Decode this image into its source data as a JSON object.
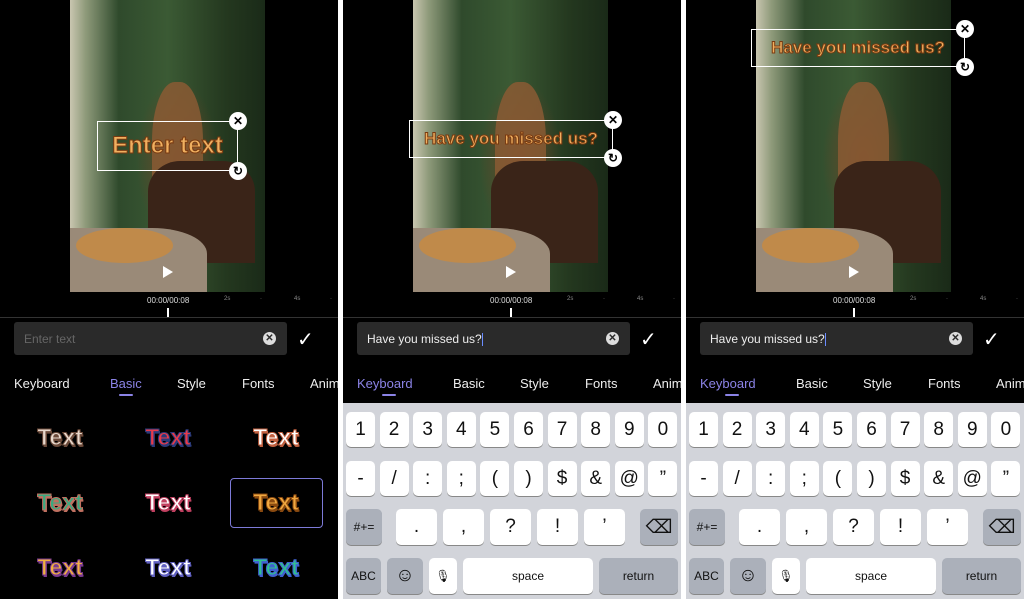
{
  "colors": {
    "accent": "#8b83e6",
    "keyboard_bg": "#d2d4da",
    "key_dark": "#abb0ba"
  },
  "timeline": {
    "time": "00:00/00:08",
    "ticks": [
      "2s",
      "·",
      "4s",
      "·"
    ]
  },
  "tabs": [
    "Keyboard",
    "Basic",
    "Style",
    "Fonts",
    "Anim"
  ],
  "panels": [
    {
      "overlay_text": "Enter text",
      "input_value": "",
      "input_placeholder": "Enter text",
      "active_tab": 1,
      "mode": "styles"
    },
    {
      "overlay_text": "Have you missed us?",
      "input_value": "Have you missed us?",
      "input_placeholder": "",
      "active_tab": 0,
      "mode": "keyboard"
    },
    {
      "overlay_text": "Have you missed us?",
      "input_value": "Have you missed us?",
      "input_placeholder": "",
      "active_tab": 0,
      "mode": "keyboard"
    }
  ],
  "styles": [
    {
      "label": "Text",
      "fill": "#e8d8cc",
      "stroke": "#6b4a3a"
    },
    {
      "label": "Text",
      "fill": "#e83a4a",
      "stroke": "#2a3a7a"
    },
    {
      "label": "Text",
      "fill": "#ffffff",
      "stroke": "#c06040"
    },
    {
      "label": "Text",
      "fill": "#3aaa80",
      "stroke": "#c07060"
    },
    {
      "label": "Text",
      "fill": "#ffffff",
      "stroke": "#c04060"
    },
    {
      "label": "Text",
      "fill": "#f0a840",
      "stroke": "#8a4a10",
      "selected": true
    },
    {
      "label": "Text",
      "fill": "#f0b040",
      "stroke": "#7a3a90"
    },
    {
      "label": "Text",
      "fill": "#ffffff",
      "stroke": "#6060c0"
    },
    {
      "label": "Text",
      "fill": "#30c090",
      "stroke": "#4060d0"
    }
  ],
  "keyboard": {
    "row1": [
      "1",
      "2",
      "3",
      "4",
      "5",
      "6",
      "7",
      "8",
      "9",
      "0"
    ],
    "row2": [
      "-",
      "/",
      ":",
      ";",
      "(",
      ")",
      "$",
      "&",
      "@",
      "”"
    ],
    "row3": [
      ".",
      ",",
      "?",
      "!",
      "’"
    ],
    "symbols_key": "#+=",
    "delete_icon": "⌫",
    "abc_key": "ABC",
    "emoji_icon": "☺",
    "mic_icon": "🎙",
    "space_key": "space",
    "return_key": "return"
  }
}
